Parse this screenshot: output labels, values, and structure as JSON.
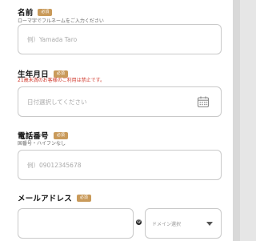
{
  "name": {
    "label": "名前",
    "required_badge": "必須",
    "hint": "ローマ字でフルネームをご入力ください",
    "placeholder": "例）Yamada Taro"
  },
  "birthdate": {
    "label": "生年月日",
    "required_badge": "必須",
    "notice": "21歳未満のお客様のご利用は禁止です。",
    "placeholder": "日付選択してください",
    "icon": "calendar-icon"
  },
  "phone": {
    "label": "電話番号",
    "required_badge": "必須",
    "hint": "国番号・ハイフンなし",
    "placeholder": "例）09012345678"
  },
  "email": {
    "label": "メールアドレス",
    "required_badge": "必須",
    "at_symbol": "@",
    "domain_placeholder": "ドメイン選択",
    "icon": "chevron-down-icon"
  },
  "colors": {
    "badge": "#c99a5a",
    "notice": "#d0372a",
    "border": "#c9c9c9"
  }
}
